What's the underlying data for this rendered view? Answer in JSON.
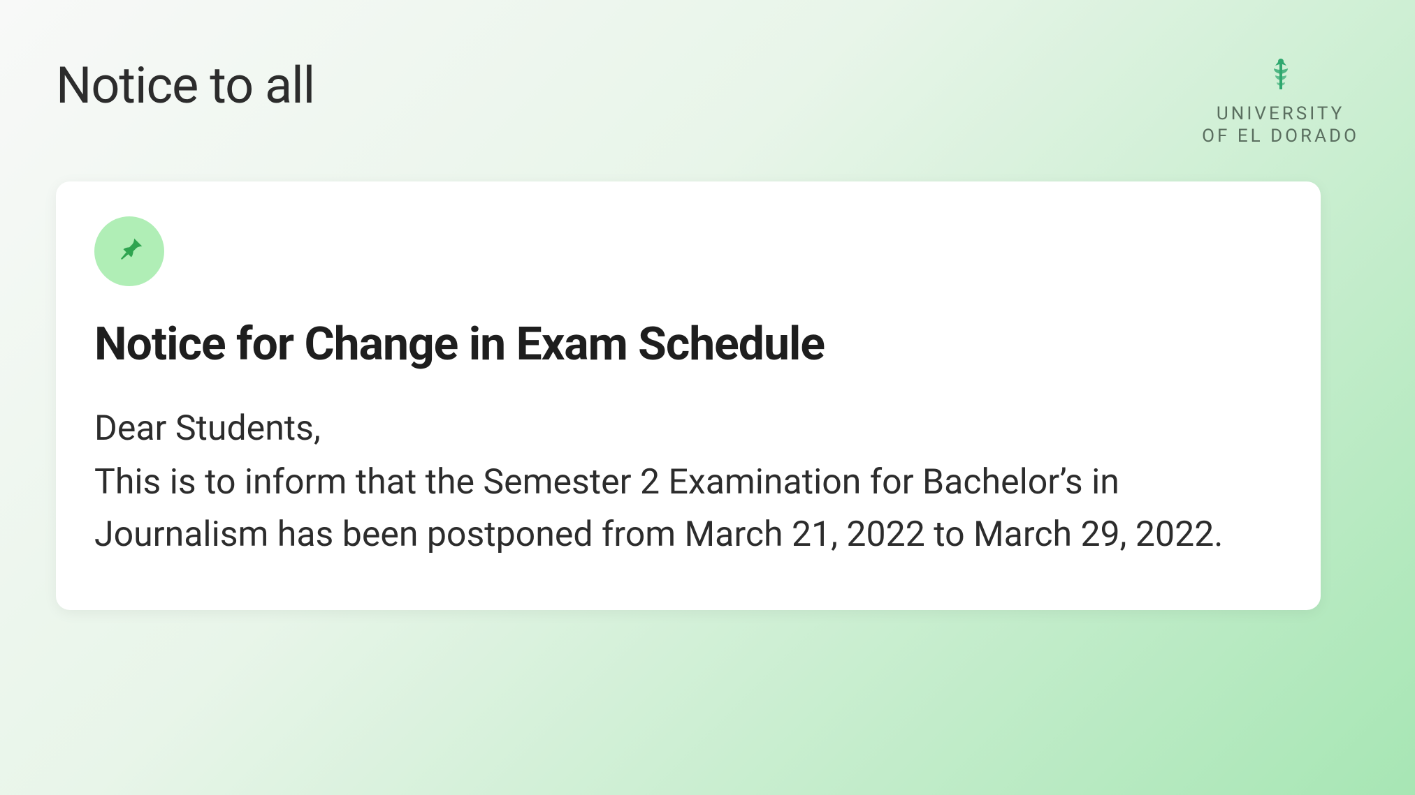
{
  "header": {
    "page_title": "Notice to all",
    "logo": {
      "line1": "UNIVERSITY",
      "line2": "OF EL DORADO"
    }
  },
  "card": {
    "title": "Notice for Change in Exam Schedule",
    "greeting": "Dear Students,",
    "body": "This is to inform that the Semester 2 Examination for Bachelor’s in Journalism has been postponed from March 21, 2022 to March 29, 2022."
  }
}
